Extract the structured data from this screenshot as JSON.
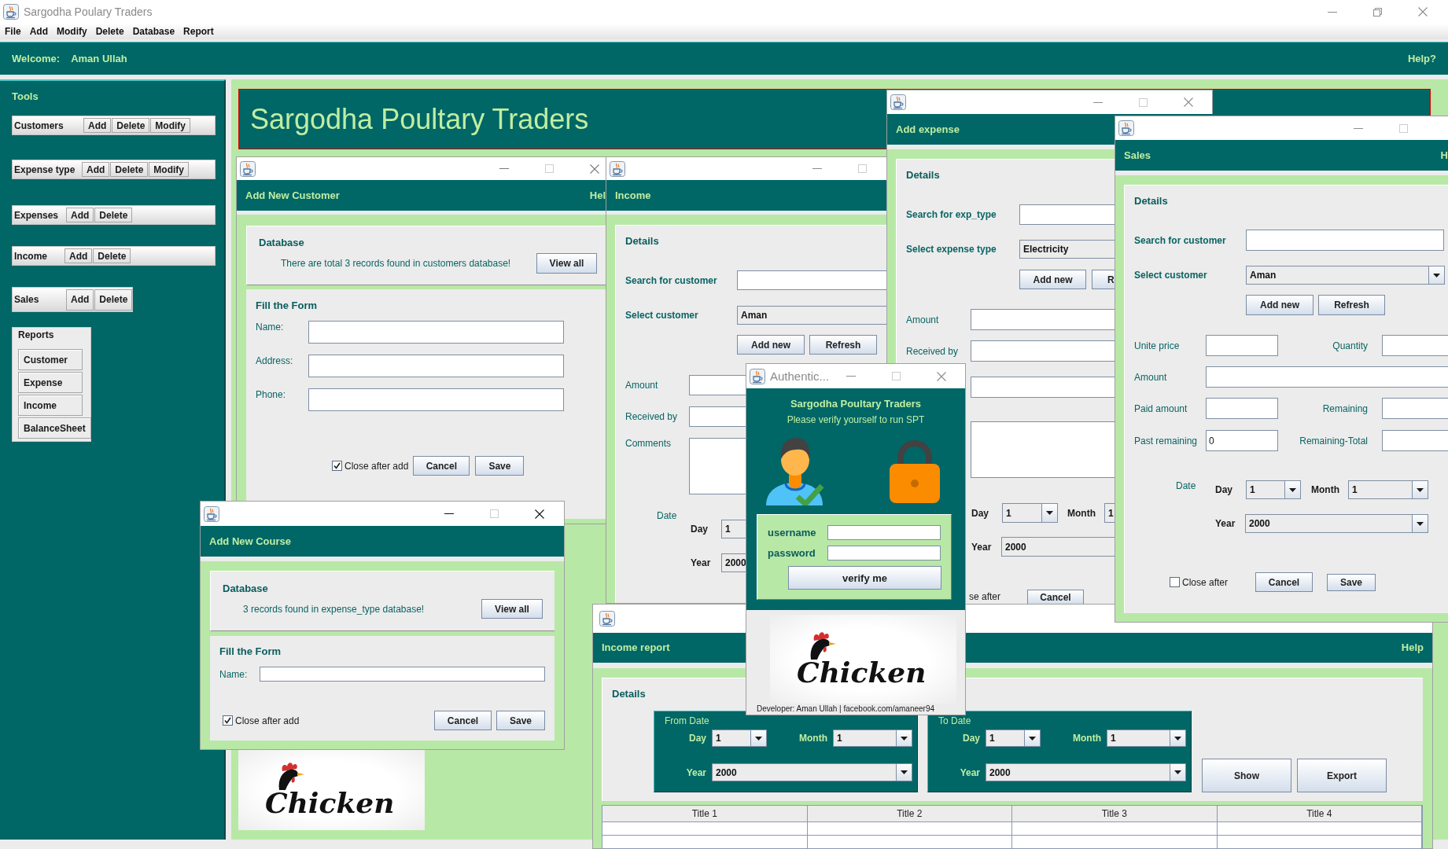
{
  "main_window": {
    "title": "Sargodha Poulary Traders",
    "menu": [
      "File",
      "Add",
      "Modify",
      "Delete",
      "Database",
      "Report"
    ],
    "welcome_label": "Welcome:",
    "user_name": "Aman Ullah",
    "help": "Help?"
  },
  "sidebar": {
    "title": "Tools",
    "groups": [
      {
        "label": "Customers",
        "buttons": [
          "Add",
          "Delete",
          "Modify"
        ]
      },
      {
        "label": "Expense type",
        "buttons": [
          "Add",
          "Delete",
          "Modify"
        ]
      },
      {
        "label": "Expenses",
        "buttons": [
          "Add",
          "Delete"
        ]
      },
      {
        "label": "Income",
        "buttons": [
          "Add",
          "Delete"
        ]
      },
      {
        "label": "Sales",
        "buttons": [
          "Add",
          "Delete"
        ]
      }
    ],
    "reports": {
      "title": "Reports",
      "buttons": [
        "Customer",
        "Expense",
        "Income",
        "BalanceSheet"
      ]
    }
  },
  "banner": {
    "title": "Sargodha Poultary Traders",
    "logo_text": "Chicken"
  },
  "add_customer_window": {
    "header": "Add New Customer",
    "help": "Hel",
    "database": {
      "title": "Database",
      "message": "There are total 3 records found in customers database!",
      "button": "View all"
    },
    "form": {
      "title": "Fill the Form",
      "fields": [
        {
          "label": "Name:"
        },
        {
          "label": "Address:"
        },
        {
          "label": "Phone:"
        }
      ]
    },
    "close_after": {
      "label": "Close after add",
      "checked": true
    },
    "buttons": [
      "Cancel",
      "Save"
    ]
  },
  "income_window": {
    "header": "Income",
    "details": "Details",
    "search_label": "Search for customer",
    "select_label": "Select customer",
    "select_value": "Aman",
    "buttons": [
      "Add new",
      "Refresh"
    ],
    "fields": [
      {
        "kind": "input",
        "label": "Amount"
      },
      {
        "kind": "input",
        "label": "Received by"
      },
      {
        "kind": "textarea",
        "label": "Comments"
      }
    ],
    "date": {
      "label": "Date",
      "day_label": "Day",
      "day": "1",
      "year_label": "Year",
      "year": "2000"
    }
  },
  "add_expense_window": {
    "header": "Add expense",
    "details": "Details",
    "search_label": "Search for exp_type",
    "select_label": "Select expense type",
    "select_value": "Electricity",
    "buttons": [
      "Add new",
      "R"
    ],
    "fields": [
      {
        "kind": "input",
        "label": "Amount"
      },
      {
        "kind": "input",
        "label": "Received by"
      },
      {
        "kind": "input"
      },
      {
        "kind": "textarea"
      }
    ],
    "date": {
      "day_label": "Day",
      "day": "1",
      "month_label": "Month",
      "month": "1",
      "year_label": "Year",
      "year": "2000"
    },
    "close_after_label": "se after",
    "bottom_buttons": [
      "Cancel"
    ]
  },
  "sales_window": {
    "header": "Sales",
    "help": "H",
    "details": "Details",
    "search_label": "Search for customer",
    "select_label": "Select customer",
    "select_value": "Aman",
    "buttons": [
      "Add new",
      "Refresh"
    ],
    "field_rows": [
      [
        {
          "label": "Unite price"
        },
        {
          "label": "Quantity"
        }
      ],
      [
        {
          "label": "Amount"
        }
      ],
      [
        {
          "label": "Paid amount"
        },
        {
          "label": "Remaining"
        }
      ],
      [
        {
          "label": "Past remaining",
          "value": "0"
        },
        {
          "label": "Remaining-Total"
        }
      ]
    ],
    "date": {
      "label": "Date",
      "day_label": "Day",
      "day": "1",
      "month_label": "Month",
      "month": "1",
      "year_label": "Year",
      "year": "2000"
    },
    "close_after": {
      "label": "Close after",
      "checked": false
    },
    "bottom_buttons": [
      "Cancel",
      "Save"
    ]
  },
  "add_course_window": {
    "header": "Add New Course",
    "database": {
      "title": "Database",
      "message": "3 records found in expense_type database!",
      "button": "View all"
    },
    "form": {
      "title": "Fill the Form",
      "fields": [
        {
          "label": "Name:"
        }
      ]
    },
    "close_after": {
      "label": "Close after add",
      "checked": true
    },
    "buttons": [
      "Cancel",
      "Save"
    ]
  },
  "income_report_window": {
    "header": "Income report",
    "help": "Help",
    "details": "Details",
    "ranges": [
      {
        "title": "From Date",
        "day_label": "Day",
        "day": "1",
        "month_label": "Month",
        "month": "1",
        "year_label": "Year",
        "year": "2000"
      },
      {
        "title": "To Date",
        "day_label": "Day",
        "day": "1",
        "month_label": "Month",
        "month": "1",
        "year_label": "Year",
        "year": "2000"
      }
    ],
    "buttons": [
      "Show",
      "Export"
    ],
    "table": {
      "columns": [
        "Title 1",
        "Title 2",
        "Title 3",
        "Title 4"
      ]
    }
  },
  "auth_window": {
    "title": "Authentic...",
    "heading": "Sargodha Poultary Traders",
    "subtitle": "Please verify yourself to run SPT",
    "fields": [
      {
        "label": "username"
      },
      {
        "label": "password"
      }
    ],
    "button": "verify me",
    "logo_text": "Chicken",
    "developer": "Developer: Aman Ullah | facebook.com/amaneer94"
  }
}
